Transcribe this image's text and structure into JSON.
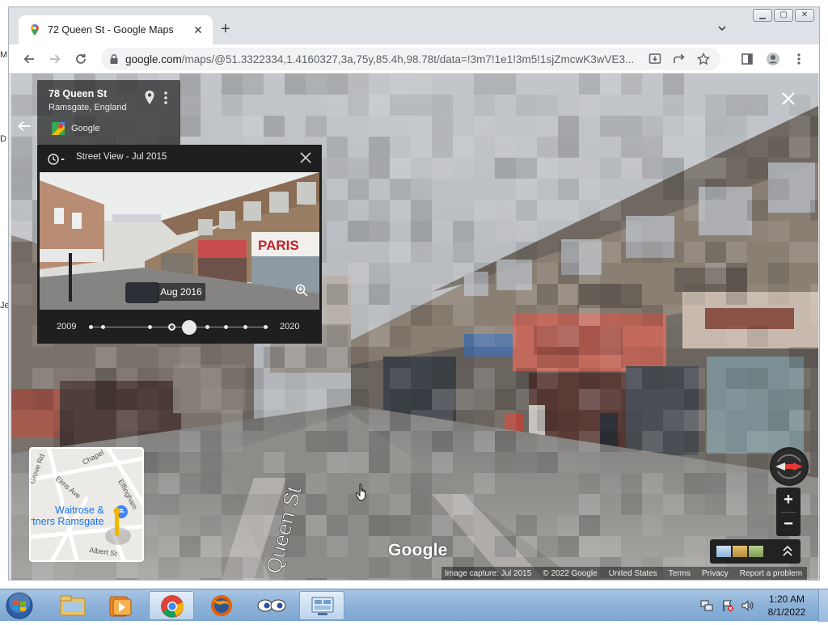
{
  "desktop": {
    "edge_letters": [
      "M",
      "D",
      "Je"
    ]
  },
  "browser": {
    "tab": {
      "title": "72 Queen St - Google Maps",
      "favicon": "google-maps-pin-icon"
    },
    "toolbar": {
      "url_host": "google.com",
      "url_path": "/maps/@51.3322334,1.4160327,3a,75y,85.4h,98.78t/data=!3m7!1e1!3m5!1sjZmcwK3wVE3..."
    },
    "window_buttons": [
      "minimize",
      "maximize",
      "close"
    ]
  },
  "streetview": {
    "place": {
      "name": "78 Queen St",
      "locality": "Ramsgate, England",
      "provider": "Google"
    },
    "timemachine": {
      "label": "Street View - Jul 2015",
      "thumb_date": "Aug 2016",
      "start_year": "2009",
      "end_year": "2020",
      "selected_fraction": 0.56,
      "thumb_shop_sign": "PARIS"
    },
    "minimap": {
      "labels": [
        "Chapel",
        "Elms Ave",
        "Effingham",
        "Grove Rd",
        "Albert St"
      ],
      "poi": "Waitrose &",
      "poi_line2": "rtners Ramsgate"
    },
    "street_label": "Queen St",
    "watermark": "Google",
    "attribution": [
      "Image capture: Jul 2015",
      "© 2022 Google",
      "United States",
      "Terms",
      "Privacy",
      "Report a problem"
    ]
  },
  "taskbar": {
    "time": "1:20 AM",
    "date": "8/1/2022",
    "apps": [
      "explorer",
      "media-player",
      "chrome",
      "firefox",
      "eyes-app",
      "control-panel"
    ]
  },
  "colors": {
    "panel_bg": "#1f1f1f",
    "chrome_frame": "#dee1e6",
    "taskbar": "#8fb3d9"
  }
}
